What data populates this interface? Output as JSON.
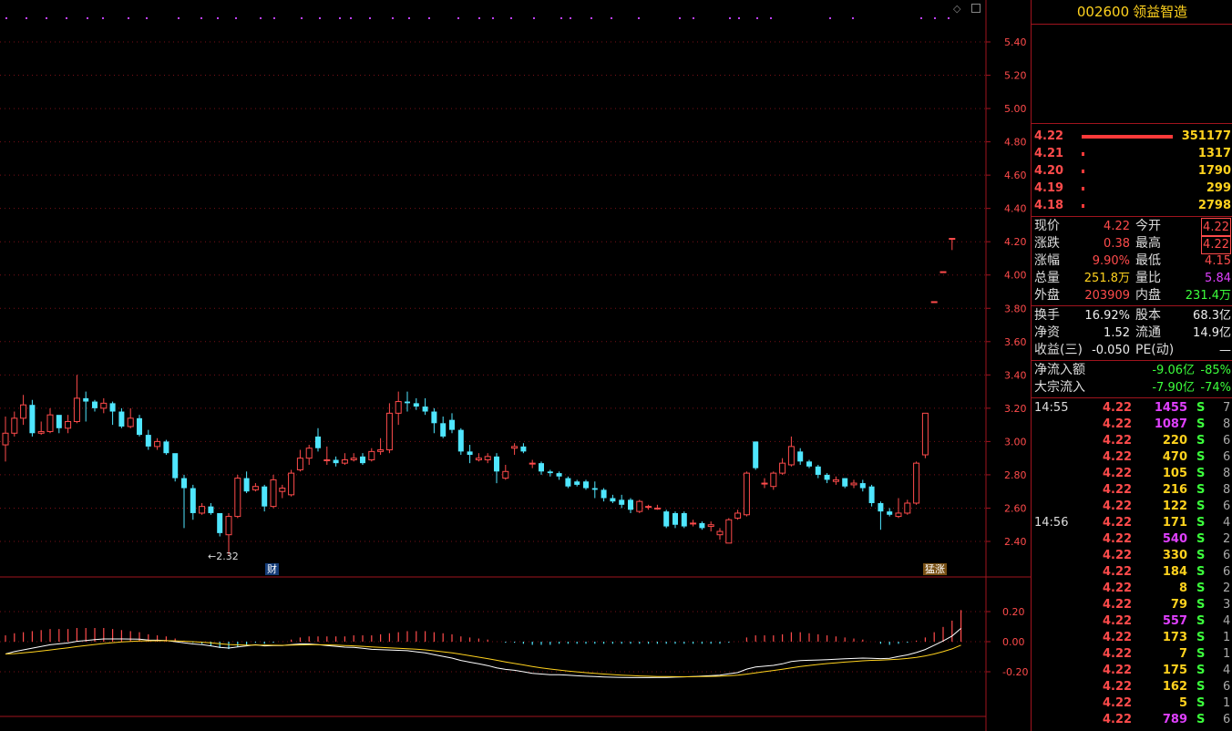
{
  "stock": {
    "code": "002600",
    "name": "领益智造"
  },
  "order_book": [
    {
      "price": "4.22",
      "volume": "351177",
      "bar": 1.0
    },
    {
      "price": "4.21",
      "volume": "1317",
      "bar": 0.02
    },
    {
      "price": "4.20",
      "volume": "1790",
      "bar": 0.02
    },
    {
      "price": "4.19",
      "volume": "299",
      "bar": 0.02
    },
    {
      "price": "4.18",
      "volume": "2798",
      "bar": 0.02
    }
  ],
  "quote": [
    {
      "l1": "现价",
      "v1": "4.22",
      "c1": "red",
      "l2": "今开",
      "v2": "4.22",
      "c2": "red",
      "box2": true
    },
    {
      "l1": "涨跌",
      "v1": "0.38",
      "c1": "red",
      "l2": "最高",
      "v2": "4.22",
      "c2": "red",
      "box2": true
    },
    {
      "l1": "涨幅",
      "v1": "9.90%",
      "c1": "red",
      "l2": "最低",
      "v2": "4.15",
      "c2": "red"
    },
    {
      "l1": "总量",
      "v1": "251.8万",
      "c1": "yel",
      "l2": "量比",
      "v2": "5.84",
      "c2": "mag"
    },
    {
      "l1": "外盘",
      "v1": "203909",
      "c1": "red",
      "l2": "内盘",
      "v2": "231.4万",
      "c2": "grn"
    }
  ],
  "fundamentals": [
    {
      "l1": "换手",
      "v1": "16.92%",
      "l2": "股本",
      "v2": "68.3亿"
    },
    {
      "l1": "净资",
      "v1": "1.52",
      "l2": "流通",
      "v2": "14.9亿"
    },
    {
      "l1": "收益(三)",
      "v1": "-0.050",
      "l2": "PE(动)",
      "v2": "—"
    }
  ],
  "flows": [
    {
      "label": "净流入额",
      "amount": "-9.06亿",
      "pct": "-85%"
    },
    {
      "label": "大宗流入",
      "amount": "-7.90亿",
      "pct": "-74%"
    }
  ],
  "ticks": [
    {
      "time": "14:55",
      "price": "4.22",
      "vol": "1455",
      "vc": "mag",
      "side": "S",
      "n": "7"
    },
    {
      "time": "",
      "price": "4.22",
      "vol": "1087",
      "vc": "mag",
      "side": "S",
      "n": "8"
    },
    {
      "time": "",
      "price": "4.22",
      "vol": "220",
      "vc": "yel",
      "side": "S",
      "n": "6"
    },
    {
      "time": "",
      "price": "4.22",
      "vol": "470",
      "vc": "yel",
      "side": "S",
      "n": "6"
    },
    {
      "time": "",
      "price": "4.22",
      "vol": "105",
      "vc": "yel",
      "side": "S",
      "n": "8"
    },
    {
      "time": "",
      "price": "4.22",
      "vol": "216",
      "vc": "yel",
      "side": "S",
      "n": "8"
    },
    {
      "time": "",
      "price": "4.22",
      "vol": "122",
      "vc": "yel",
      "side": "S",
      "n": "6"
    },
    {
      "time": "14:56",
      "price": "4.22",
      "vol": "171",
      "vc": "yel",
      "side": "S",
      "n": "4"
    },
    {
      "time": "",
      "price": "4.22",
      "vol": "540",
      "vc": "mag",
      "side": "S",
      "n": "2"
    },
    {
      "time": "",
      "price": "4.22",
      "vol": "330",
      "vc": "yel",
      "side": "S",
      "n": "6"
    },
    {
      "time": "",
      "price": "4.22",
      "vol": "184",
      "vc": "yel",
      "side": "S",
      "n": "6"
    },
    {
      "time": "",
      "price": "4.22",
      "vol": "8",
      "vc": "yel",
      "side": "S",
      "n": "2"
    },
    {
      "time": "",
      "price": "4.22",
      "vol": "79",
      "vc": "yel",
      "side": "S",
      "n": "3"
    },
    {
      "time": "",
      "price": "4.22",
      "vol": "557",
      "vc": "mag",
      "side": "S",
      "n": "4"
    },
    {
      "time": "",
      "price": "4.22",
      "vol": "173",
      "vc": "yel",
      "side": "S",
      "n": "1"
    },
    {
      "time": "",
      "price": "4.22",
      "vol": "7",
      "vc": "yel",
      "side": "S",
      "n": "1"
    },
    {
      "time": "",
      "price": "4.22",
      "vol": "175",
      "vc": "yel",
      "side": "S",
      "n": "4"
    },
    {
      "time": "",
      "price": "4.22",
      "vol": "162",
      "vc": "yel",
      "side": "S",
      "n": "6"
    },
    {
      "time": "",
      "price": "4.22",
      "vol": "5",
      "vc": "yel",
      "side": "S",
      "n": "1"
    },
    {
      "time": "",
      "price": "4.22",
      "vol": "789",
      "vc": "mag",
      "side": "S",
      "n": "6"
    }
  ],
  "chart_labels": {
    "low_marker": "←2.32",
    "tag_cai": "财",
    "tag_zhang": "猛涨"
  },
  "chart_data": [
    {
      "type": "candlestick",
      "y_ticks": [
        "5.40",
        "5.20",
        "5.00",
        "4.80",
        "4.60",
        "4.40",
        "4.20",
        "4.00",
        "3.80",
        "3.60",
        "3.40",
        "3.20",
        "3.00",
        "2.80",
        "2.60",
        "2.40"
      ],
      "ylim": [
        2.3,
        5.5
      ],
      "up_color": "#ff4b4b",
      "down_color": "#4fe6ff",
      "candles": [
        [
          2.98,
          3.05,
          3.15,
          2.88
        ],
        [
          3.05,
          3.14,
          3.18,
          3.03
        ],
        [
          3.14,
          3.22,
          3.28,
          3.1
        ],
        [
          3.22,
          3.05,
          3.25,
          3.03
        ],
        [
          3.05,
          3.06,
          3.12,
          3.04
        ],
        [
          3.06,
          3.16,
          3.2,
          3.05
        ],
        [
          3.16,
          3.08,
          3.12,
          3.05
        ],
        [
          3.08,
          3.12,
          3.16,
          3.05
        ],
        [
          3.12,
          3.26,
          3.4,
          3.11
        ],
        [
          3.26,
          3.24,
          3.3,
          3.12
        ],
        [
          3.24,
          3.2,
          3.25,
          3.18
        ],
        [
          3.2,
          3.23,
          3.26,
          3.17
        ],
        [
          3.23,
          3.18,
          3.24,
          3.1
        ],
        [
          3.18,
          3.09,
          3.2,
          3.08
        ],
        [
          3.09,
          3.14,
          3.2,
          3.08
        ],
        [
          3.14,
          3.04,
          3.16,
          3.03
        ],
        [
          3.04,
          2.97,
          3.07,
          2.95
        ],
        [
          2.97,
          3.0,
          3.02,
          2.95
        ],
        [
          3.0,
          2.93,
          3.01,
          2.92
        ],
        [
          2.93,
          2.78,
          2.86,
          2.76
        ],
        [
          2.78,
          2.72,
          2.8,
          2.48
        ],
        [
          2.72,
          2.57,
          2.74,
          2.53
        ],
        [
          2.57,
          2.61,
          2.63,
          2.56
        ],
        [
          2.61,
          2.57,
          2.63,
          2.56
        ],
        [
          2.57,
          2.45,
          2.53,
          2.43
        ],
        [
          2.44,
          2.55,
          2.57,
          2.32
        ],
        [
          2.55,
          2.78,
          2.8,
          2.54
        ],
        [
          2.78,
          2.7,
          2.82,
          2.69
        ],
        [
          2.71,
          2.73,
          2.75,
          2.7
        ],
        [
          2.73,
          2.61,
          2.74,
          2.58
        ],
        [
          2.61,
          2.77,
          2.8,
          2.6
        ],
        [
          2.7,
          2.72,
          2.74,
          2.66
        ],
        [
          2.68,
          2.81,
          2.83,
          2.67
        ],
        [
          2.83,
          2.9,
          2.95,
          2.82
        ],
        [
          2.9,
          2.96,
          2.98,
          2.86
        ],
        [
          3.03,
          2.96,
          3.08,
          2.94
        ],
        [
          2.89,
          2.89,
          2.97,
          2.86
        ],
        [
          2.89,
          2.87,
          2.91,
          2.85
        ],
        [
          2.87,
          2.89,
          2.93,
          2.86
        ],
        [
          2.89,
          2.9,
          2.93,
          2.88
        ],
        [
          2.91,
          2.87,
          2.93,
          2.86
        ],
        [
          2.89,
          2.94,
          2.96,
          2.88
        ],
        [
          2.94,
          2.95,
          3.02,
          2.92
        ],
        [
          2.95,
          3.17,
          3.23,
          2.93
        ],
        [
          3.17,
          3.24,
          3.3,
          3.1
        ],
        [
          3.24,
          3.23,
          3.3,
          3.18
        ],
        [
          3.23,
          3.21,
          3.26,
          3.19
        ],
        [
          3.21,
          3.18,
          3.26,
          3.16
        ],
        [
          3.18,
          3.11,
          3.2,
          3.05
        ],
        [
          3.11,
          3.03,
          3.15,
          3.02
        ],
        [
          3.13,
          3.07,
          3.17,
          3.05
        ],
        [
          3.07,
          2.94,
          3.08,
          2.92
        ],
        [
          2.94,
          2.92,
          2.98,
          2.87
        ],
        [
          2.89,
          2.9,
          2.93,
          2.88
        ],
        [
          2.89,
          2.91,
          2.93,
          2.87
        ],
        [
          2.91,
          2.82,
          2.93,
          2.75
        ],
        [
          2.78,
          2.82,
          2.86,
          2.77
        ],
        [
          2.96,
          2.97,
          2.99,
          2.92
        ],
        [
          2.97,
          2.94,
          2.99,
          2.93
        ],
        [
          2.87,
          2.87,
          2.89,
          2.84
        ],
        [
          2.87,
          2.82,
          2.88,
          2.8
        ],
        [
          2.82,
          2.81,
          2.83,
          2.79
        ],
        [
          2.81,
          2.79,
          2.82,
          2.77
        ],
        [
          2.78,
          2.73,
          2.79,
          2.72
        ],
        [
          2.76,
          2.74,
          2.77,
          2.73
        ],
        [
          2.76,
          2.72,
          2.77,
          2.71
        ],
        [
          2.72,
          2.71,
          2.76,
          2.66
        ],
        [
          2.71,
          2.66,
          2.72,
          2.64
        ],
        [
          2.66,
          2.64,
          2.68,
          2.63
        ],
        [
          2.65,
          2.62,
          2.68,
          2.6
        ],
        [
          2.65,
          2.59,
          2.66,
          2.57
        ],
        [
          2.58,
          2.64,
          2.65,
          2.57
        ],
        [
          2.61,
          2.61,
          2.62,
          2.59
        ],
        [
          2.6,
          2.6,
          2.62,
          2.59
        ],
        [
          2.58,
          2.49,
          2.59,
          2.48
        ],
        [
          2.57,
          2.5,
          2.58,
          2.48
        ],
        [
          2.57,
          2.49,
          2.58,
          2.48
        ],
        [
          2.51,
          2.51,
          2.53,
          2.49
        ],
        [
          2.51,
          2.48,
          2.52,
          2.47
        ],
        [
          2.49,
          2.5,
          2.52,
          2.46
        ],
        [
          2.44,
          2.46,
          2.48,
          2.41
        ],
        [
          2.39,
          2.53,
          2.54,
          2.39
        ],
        [
          2.54,
          2.57,
          2.59,
          2.53
        ],
        [
          2.56,
          2.81,
          2.82,
          2.55
        ],
        [
          3.0,
          2.84,
          3.0,
          2.83
        ],
        [
          2.75,
          2.75,
          2.78,
          2.72
        ],
        [
          2.73,
          2.81,
          2.82,
          2.71
        ],
        [
          2.81,
          2.87,
          2.9,
          2.8
        ],
        [
          2.86,
          2.97,
          3.03,
          2.85
        ],
        [
          2.94,
          2.88,
          2.96,
          2.86
        ],
        [
          2.88,
          2.85,
          2.89,
          2.84
        ],
        [
          2.85,
          2.8,
          2.86,
          2.78
        ],
        [
          2.8,
          2.77,
          2.81,
          2.75
        ],
        [
          2.76,
          2.77,
          2.79,
          2.74
        ],
        [
          2.78,
          2.73,
          2.78,
          2.72
        ],
        [
          2.74,
          2.75,
          2.77,
          2.72
        ],
        [
          2.75,
          2.72,
          2.77,
          2.7
        ],
        [
          2.73,
          2.63,
          2.74,
          2.61
        ],
        [
          2.63,
          2.58,
          2.64,
          2.47
        ],
        [
          2.58,
          2.56,
          2.6,
          2.55
        ],
        [
          2.55,
          2.57,
          2.66,
          2.54
        ],
        [
          2.57,
          2.63,
          2.65,
          2.56
        ],
        [
          2.63,
          2.87,
          2.88,
          2.62
        ],
        [
          2.92,
          3.17,
          3.17,
          2.9
        ],
        [
          3.84,
          3.84,
          3.84,
          3.84
        ],
        [
          4.02,
          4.02,
          4.02,
          4.02
        ],
        [
          4.22,
          4.22,
          4.22,
          4.15
        ]
      ]
    },
    {
      "type": "bar+line",
      "y_ticks": [
        "0.20",
        "0.00",
        "-0.20"
      ],
      "ylim": [
        -0.33,
        0.33
      ],
      "series": [
        {
          "values": [
            0.06,
            0.08,
            0.09,
            0.1,
            0.11,
            0.12,
            0.12,
            0.12,
            0.13,
            0.13,
            0.13,
            0.13,
            0.12,
            0.11,
            0.1,
            0.09,
            0.07,
            0.06,
            0.05,
            0.03,
            0.01,
            -0.01,
            -0.02,
            -0.04,
            -0.06,
            -0.07,
            -0.05,
            -0.03,
            -0.01,
            -0.02,
            -0.01,
            0.0,
            0.02,
            0.04,
            0.05,
            0.05,
            0.05,
            0.05,
            0.05,
            0.06,
            0.06,
            0.06,
            0.07,
            0.08,
            0.09,
            0.1,
            0.1,
            0.1,
            0.09,
            0.08,
            0.07,
            0.05,
            0.04,
            0.03,
            0.02,
            0.0,
            -0.01,
            -0.01,
            -0.02,
            -0.03,
            -0.03,
            -0.03,
            -0.02,
            -0.02,
            -0.02,
            -0.02,
            -0.02,
            -0.02,
            -0.02,
            -0.02,
            -0.02,
            -0.02,
            -0.02,
            -0.02,
            -0.02,
            -0.02,
            -0.02,
            -0.02,
            -0.02,
            -0.02,
            -0.02,
            -0.01,
            0.0,
            0.04,
            0.06,
            0.06,
            0.06,
            0.07,
            0.09,
            0.09,
            0.08,
            0.07,
            0.06,
            0.05,
            0.04,
            0.03,
            0.02,
            0.0,
            -0.02,
            -0.03,
            -0.02,
            -0.01,
            0.01,
            0.04,
            0.09,
            0.14,
            0.2,
            0.3
          ]
        }
      ]
    }
  ]
}
